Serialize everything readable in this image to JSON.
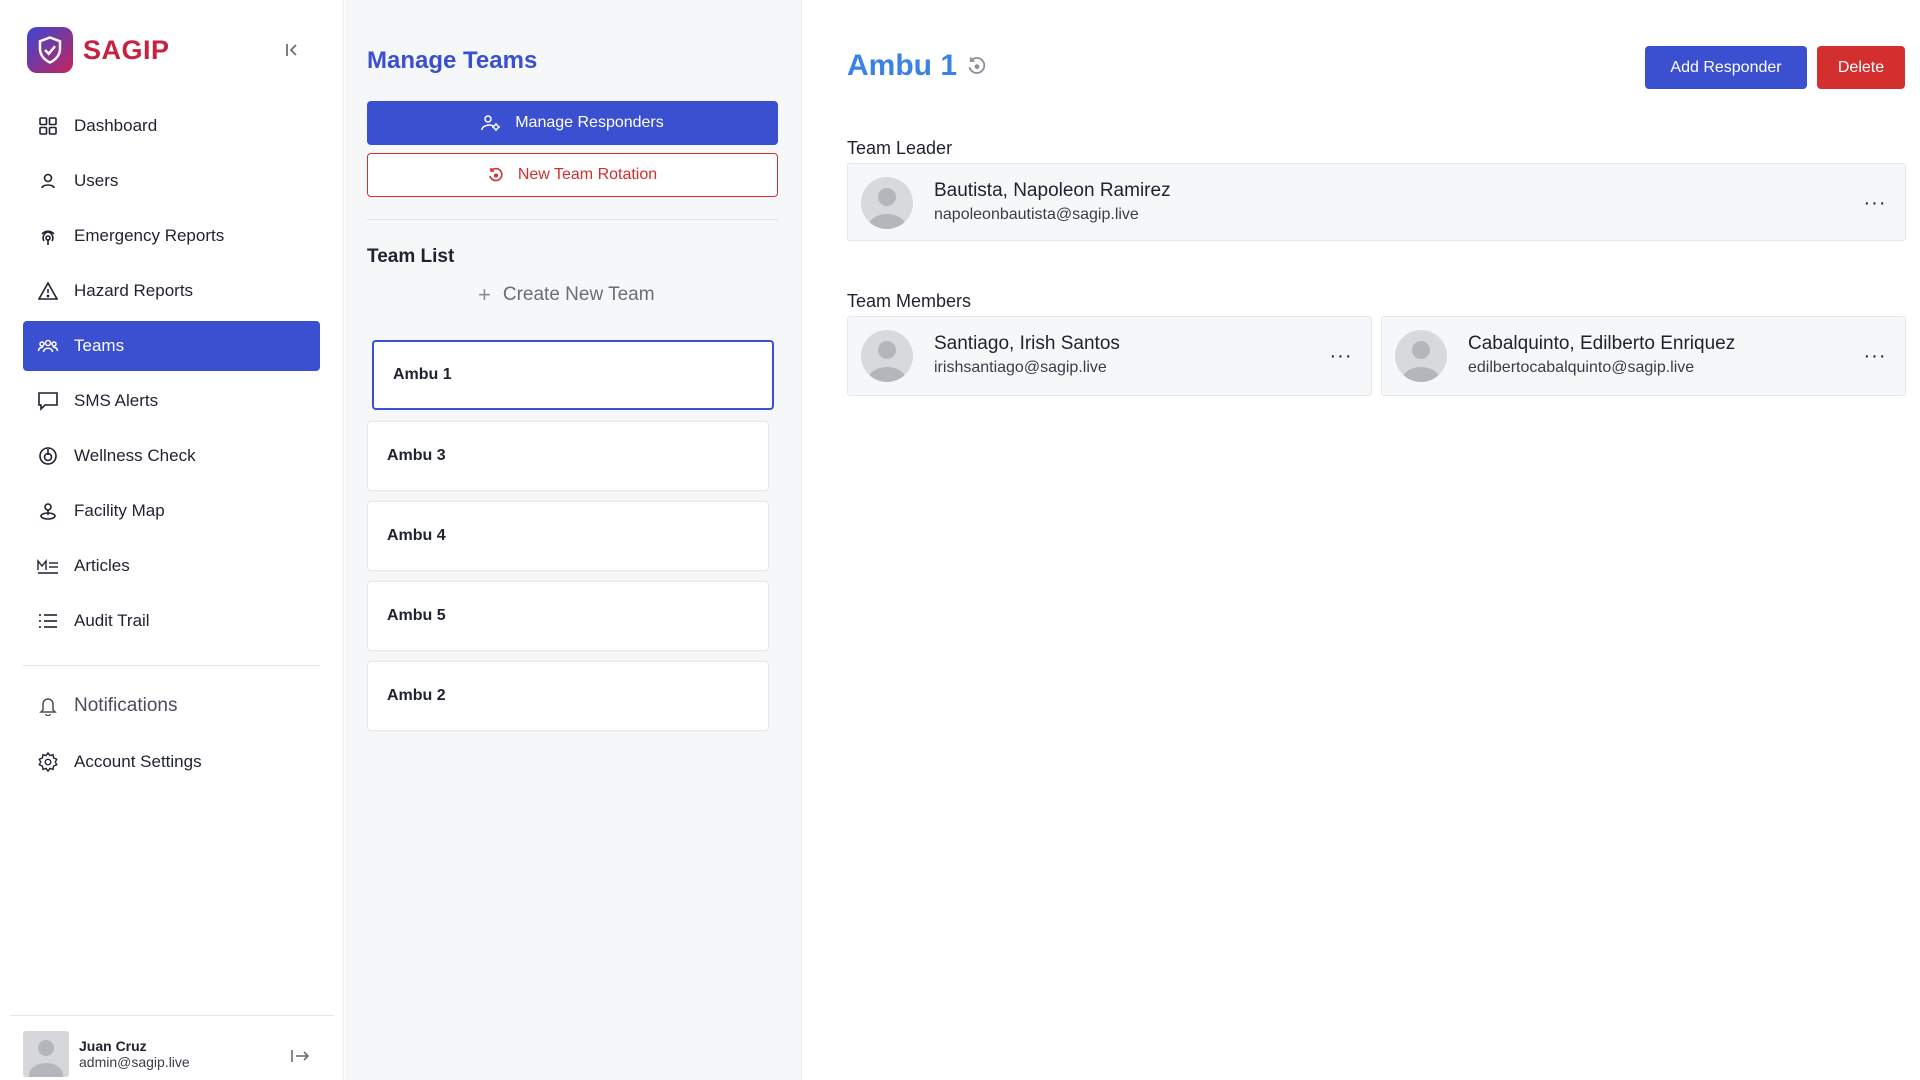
{
  "brand": {
    "name": "SAGIP"
  },
  "sidebar": {
    "items": [
      {
        "label": "Dashboard",
        "icon": "grid-icon"
      },
      {
        "label": "Users",
        "icon": "user-icon"
      },
      {
        "label": "Emergency Reports",
        "icon": "siren-icon"
      },
      {
        "label": "Hazard Reports",
        "icon": "warning-triangle-icon"
      },
      {
        "label": "Teams",
        "icon": "team-icon",
        "active": true
      },
      {
        "label": "SMS Alerts",
        "icon": "message-icon"
      },
      {
        "label": "Wellness Check",
        "icon": "wellness-icon"
      },
      {
        "label": "Facility Map",
        "icon": "map-pin-icon"
      },
      {
        "label": "Articles",
        "icon": "markdown-icon"
      },
      {
        "label": "Audit Trail",
        "icon": "list-icon"
      }
    ],
    "secondary": [
      {
        "label": "Notifications",
        "icon": "bell-icon"
      },
      {
        "label": "Account Settings",
        "icon": "gear-icon"
      }
    ],
    "user": {
      "name": "Juan Cruz",
      "email": "admin@sagip.live"
    }
  },
  "middle": {
    "title": "Manage Teams",
    "manage_responders_label": "Manage Responders",
    "new_rotation_label": "New Team Rotation",
    "team_list_label": "Team List",
    "create_team_label": "Create New Team",
    "teams": [
      "Ambu 1",
      "Ambu 3",
      "Ambu 4",
      "Ambu 5",
      "Ambu 2"
    ]
  },
  "main": {
    "team_name": "Ambu 1",
    "add_responder_label": "Add Responder",
    "delete_label": "Delete",
    "leader_label": "Team Leader",
    "leader": {
      "name": "Bautista, Napoleon Ramirez",
      "email": "napoleonbautista@sagip.live"
    },
    "members_label": "Team Members",
    "members": [
      {
        "name": "Santiago, Irish Santos",
        "email": "irishsantiago@sagip.live"
      },
      {
        "name": "Cabalquinto, Edilberto Enriquez",
        "email": "edilbertocabalquinto@sagip.live"
      }
    ],
    "more_label": "···"
  },
  "colors": {
    "primary": "#3b4fd1",
    "danger": "#d32f2f",
    "title_blue": "#3b82e8",
    "brand_red": "#c62242"
  }
}
